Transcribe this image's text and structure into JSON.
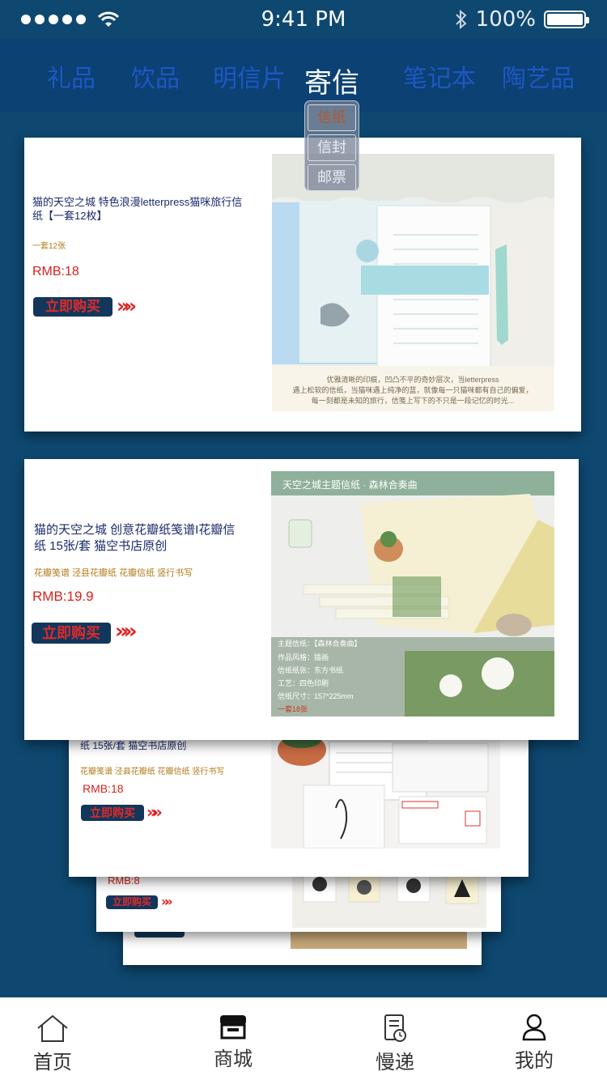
{
  "status": {
    "time": "9:41 PM",
    "battery": "100%"
  },
  "tabs": [
    {
      "label": "礼品"
    },
    {
      "label": "饮品"
    },
    {
      "label": "明信片"
    },
    {
      "label": "寄信"
    },
    {
      "label": "笔记本"
    },
    {
      "label": "陶艺品"
    }
  ],
  "active_tab": "寄信",
  "dropdown": {
    "items": [
      {
        "label": "信纸"
      },
      {
        "label": "信封"
      },
      {
        "label": "邮票"
      }
    ],
    "selected": "信纸"
  },
  "cards": [
    {
      "title": "猫的天空之城 特色浪漫letterpress猫咪旅行信纸【一套12枚】",
      "tags": "一套12张",
      "price": "RMB:18",
      "buy_label": "立即购买",
      "image_caption_1": "优雅清晰的印痕，凹凸不平的奇妙层次，当letterpress",
      "image_caption_2": "遇上松软的信纸，当猫咪遇上纯净的蓝，就像每一只猫咪都有自己的偏爱，",
      "image_caption_3": "每一刻都是未知的旅行，信笺上写下的不只是一段记忆的时光..."
    },
    {
      "title": "猫的天空之城 创意花瓣纸笺谱I花瓣信纸 15张/套 猫空书店原创",
      "tags": "花瓣笺谱 泾县花瓣纸 花瓣信纸 竖行书写",
      "price": "RMB:19.9",
      "buy_label": "立即购买",
      "image_header": "天空之城主题信纸 · 森林合奏曲",
      "spec_1": "主题信纸：【森林合奏曲】",
      "spec_2": "作品风格：插画",
      "spec_3": "信纸纸张：东方书纸",
      "spec_4": "工艺：四色印刷",
      "spec_5": "信纸尺寸：157*225mm",
      "spec_6": "一套18张"
    },
    {
      "title": "纸 15张/套 猫空书店原创",
      "tags": "花瓣笺谱 泾县花瓣纸 花瓣信纸 竖行书写",
      "price": "RMB:18",
      "buy_label": "立即购买"
    },
    {
      "price": "RMB:8",
      "buy_label": "立即购买"
    }
  ],
  "bottom_nav": [
    {
      "label": "首页",
      "icon": "home-icon"
    },
    {
      "label": "商城",
      "icon": "shop-icon"
    },
    {
      "label": "慢递",
      "icon": "slow-mail-icon"
    },
    {
      "label": "我的",
      "icon": "user-icon"
    }
  ],
  "colors": {
    "background": "#0e4870",
    "tab_bar": "#0b4173",
    "tab_inactive": "#1f57c4",
    "price": "#d7231e",
    "buy_button": "#12375b",
    "buy_text": "#e02a2a",
    "dropdown_selected": "#b4562a"
  }
}
